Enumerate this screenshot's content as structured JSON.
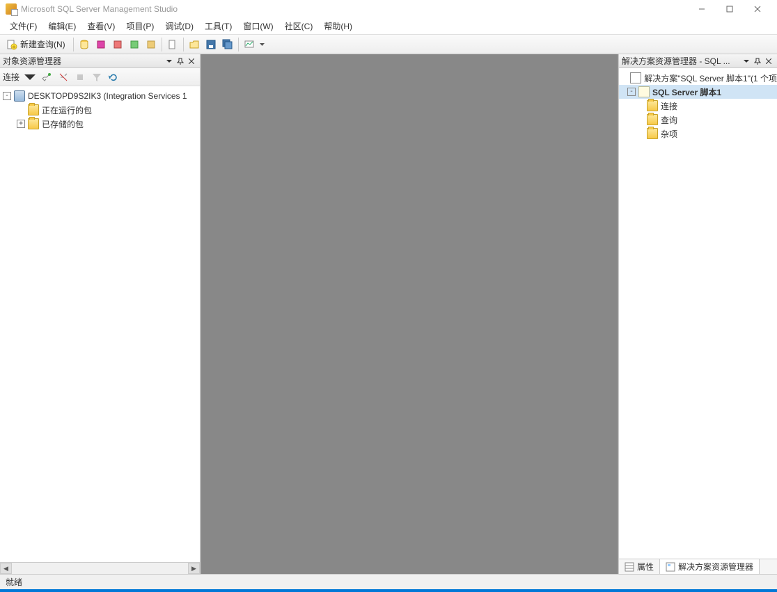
{
  "window": {
    "title": "Microsoft SQL Server Management Studio"
  },
  "menu": {
    "file": "文件(F)",
    "edit": "编辑(E)",
    "view": "查看(V)",
    "project": "项目(P)",
    "debug": "调试(D)",
    "tools": "工具(T)",
    "window": "窗口(W)",
    "community": "社区(C)",
    "help": "帮助(H)"
  },
  "toolbar": {
    "new_query": "新建查询(N)"
  },
  "object_explorer": {
    "title": "对象资源管理器",
    "connect_label": "连接",
    "tree": {
      "server": "DESKTOPD9S2IK3 (Integration Services 1",
      "running": "正在运行的包",
      "stored": "已存储的包"
    }
  },
  "solution_explorer": {
    "title": "解决方案资源管理器 - SQL ...",
    "solution": "解决方案\"SQL Server 脚本1\"(1 个项",
    "project": "SQL Server 脚本1",
    "connections": "连接",
    "queries": "查询",
    "misc": "杂项"
  },
  "tabs": {
    "properties": "属性",
    "solution_explorer": "解决方案资源管理器"
  },
  "status": {
    "text": "就绪"
  }
}
